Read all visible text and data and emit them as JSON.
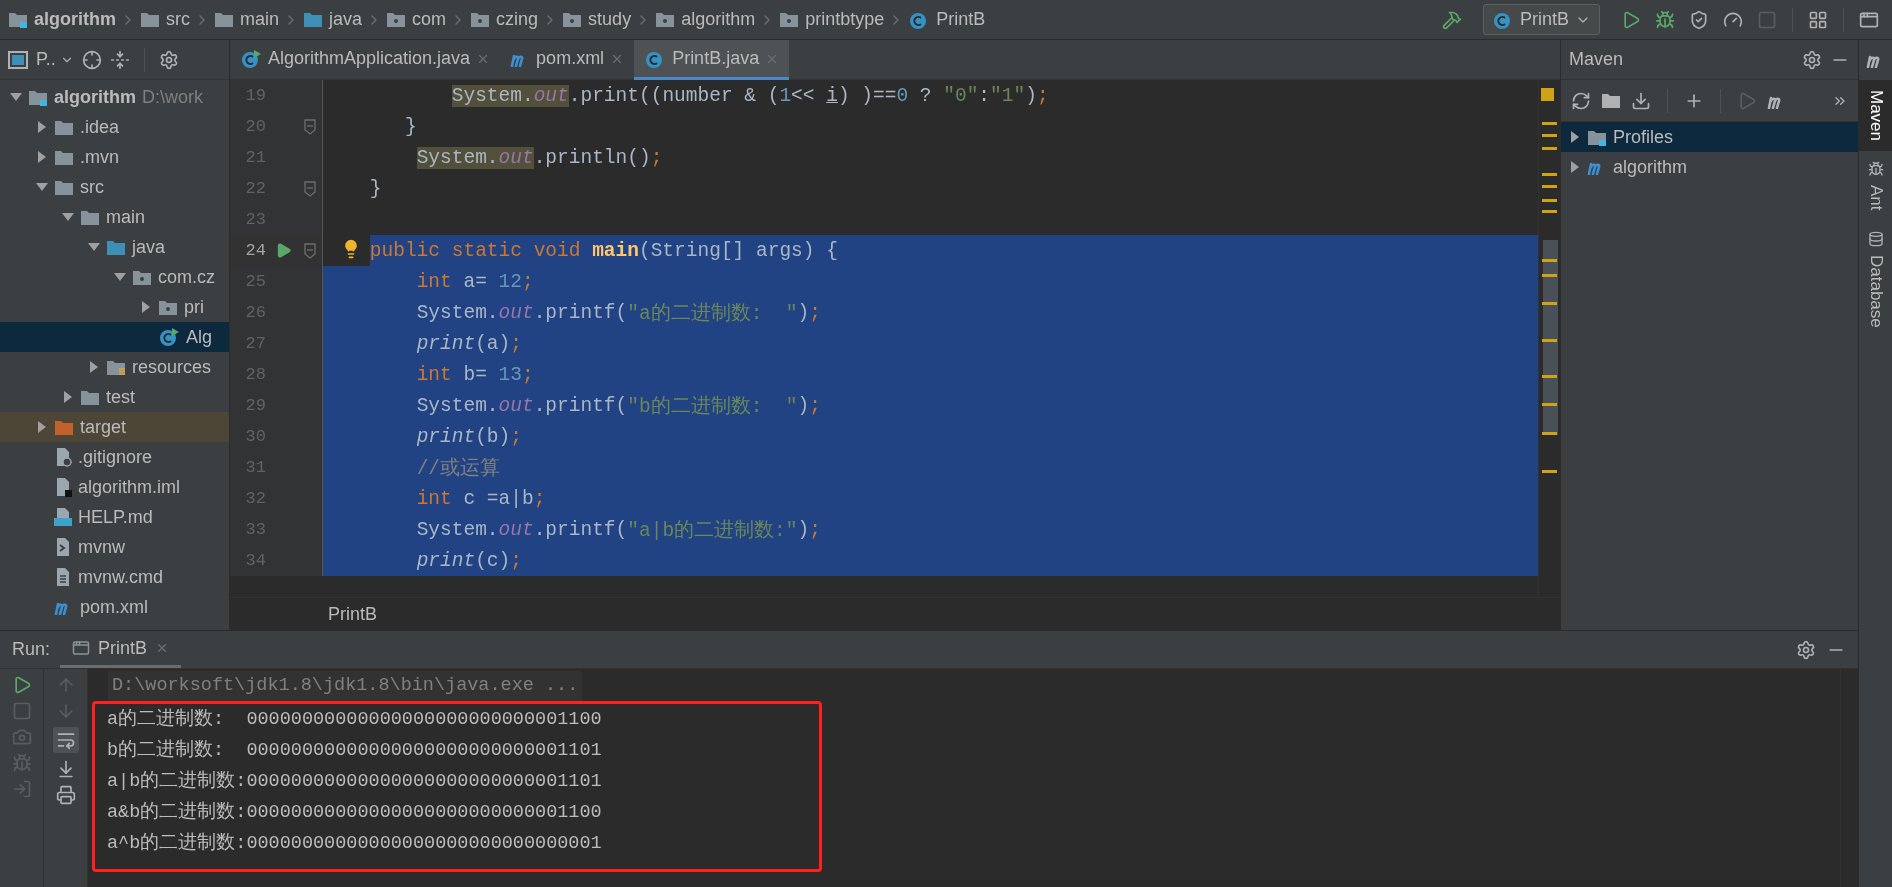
{
  "breadcrumbs": [
    {
      "label": "algorithm",
      "kind": "module"
    },
    {
      "label": "src",
      "kind": "folder"
    },
    {
      "label": "main",
      "kind": "folder"
    },
    {
      "label": "java",
      "kind": "source"
    },
    {
      "label": "com",
      "kind": "package"
    },
    {
      "label": "czing",
      "kind": "package"
    },
    {
      "label": "study",
      "kind": "package"
    },
    {
      "label": "algorithm",
      "kind": "package"
    },
    {
      "label": "printbtype",
      "kind": "package"
    },
    {
      "label": "PrintB",
      "kind": "class"
    }
  ],
  "run_config": {
    "label": "PrintB"
  },
  "project_panel": {
    "title": "P.."
  },
  "project_tree": [
    {
      "label": "algorithm",
      "path": "D:\\work",
      "kind": "module",
      "expanded": true,
      "selected": false,
      "children": [
        {
          "label": ".idea",
          "kind": "folder",
          "expanded": false,
          "selected": false
        },
        {
          "label": ".mvn",
          "kind": "folder",
          "expanded": false,
          "selected": false
        },
        {
          "label": "src",
          "kind": "folder",
          "expanded": true,
          "selected": false,
          "children": [
            {
              "label": "main",
              "kind": "folder",
              "expanded": true,
              "selected": false,
              "children": [
                {
                  "label": "java",
                  "kind": "source",
                  "expanded": true,
                  "selected": false,
                  "children": [
                    {
                      "label": "com.cz",
                      "kind": "package",
                      "expanded": true,
                      "selected": false,
                      "children": [
                        {
                          "label": "pri",
                          "kind": "package",
                          "expanded": false,
                          "selected": false
                        },
                        {
                          "label": "Alg",
                          "kind": "appclass",
                          "selected": true
                        }
                      ]
                    }
                  ]
                },
                {
                  "label": "resources",
                  "kind": "resources",
                  "expanded": false,
                  "selected": false
                }
              ]
            },
            {
              "label": "test",
              "kind": "folder",
              "expanded": false,
              "selected": false
            }
          ]
        },
        {
          "label": "target",
          "kind": "excluded",
          "expanded": false,
          "selected": false
        },
        {
          "label": ".gitignore",
          "kind": "ignore",
          "selected": false
        },
        {
          "label": "algorithm.iml",
          "kind": "iml",
          "selected": false
        },
        {
          "label": "HELP.md",
          "kind": "markdown",
          "selected": false
        },
        {
          "label": "mvnw",
          "kind": "shell",
          "selected": false
        },
        {
          "label": "mvnw.cmd",
          "kind": "text",
          "selected": false
        },
        {
          "label": "pom.xml",
          "kind": "maven",
          "selected": false
        }
      ]
    }
  ],
  "editor_tabs": [
    {
      "label": "AlgorithmApplication.java",
      "kind": "appclass",
      "selected": false
    },
    {
      "label": "pom.xml",
      "kind": "maven",
      "selected": false
    },
    {
      "label": "PrintB.java",
      "kind": "class",
      "selected": true
    }
  ],
  "code_lines": [
    {
      "number": "19",
      "caret": false,
      "run": false,
      "fold": false,
      "bulb": false,
      "selected": false,
      "segments": [
        {
          "text": "           System.",
          "kind": "usage"
        },
        {
          "text": "out",
          "kind": "usagefield"
        },
        {
          "text": ".print((number & (",
          "kind": "plain"
        },
        {
          "text": "1",
          "kind": "number"
        },
        {
          "text": "<< ",
          "kind": "plain"
        },
        {
          "text": "i",
          "kind": "var"
        },
        {
          "text": ") )==",
          "kind": "plain"
        },
        {
          "text": "0",
          "kind": "number"
        },
        {
          "text": " ? ",
          "kind": "plain"
        },
        {
          "text": "\"0\"",
          "kind": "string"
        },
        {
          "text": ":",
          "kind": "plain"
        },
        {
          "text": "\"1\"",
          "kind": "string"
        },
        {
          "text": ")",
          "kind": "plain"
        },
        {
          "text": ";",
          "kind": "punct"
        }
      ]
    },
    {
      "number": "20",
      "caret": false,
      "run": false,
      "fold": true,
      "bulb": false,
      "selected": false,
      "segments": [
        {
          "text": "       }",
          "kind": "plain"
        }
      ]
    },
    {
      "number": "21",
      "caret": false,
      "run": false,
      "fold": false,
      "bulb": false,
      "selected": false,
      "segments": [
        {
          "text": "        System.",
          "kind": "usage"
        },
        {
          "text": "out",
          "kind": "usagefield"
        },
        {
          "text": ".println()",
          "kind": "plain"
        },
        {
          "text": ";",
          "kind": "punct"
        }
      ]
    },
    {
      "number": "22",
      "caret": false,
      "run": false,
      "fold": true,
      "bulb": false,
      "selected": false,
      "segments": [
        {
          "text": "    }",
          "kind": "plain"
        }
      ]
    },
    {
      "number": "23",
      "caret": false,
      "run": false,
      "fold": false,
      "bulb": false,
      "selected": false
    },
    {
      "number": "24",
      "caret": true,
      "run": true,
      "fold": true,
      "bulb": true,
      "selected": true,
      "segments": [
        {
          "text": "    public static void ",
          "kind": "keyword"
        },
        {
          "text": "main",
          "kind": "decl"
        },
        {
          "text": "(String[] args) {",
          "kind": "plain"
        }
      ]
    },
    {
      "number": "25",
      "caret": false,
      "run": false,
      "fold": false,
      "bulb": false,
      "selected": true,
      "segments": [
        {
          "text": "        int",
          "kind": "keyword"
        },
        {
          "text": " a= ",
          "kind": "plain"
        },
        {
          "text": "12",
          "kind": "number"
        },
        {
          "text": ";",
          "kind": "punct"
        }
      ]
    },
    {
      "number": "26",
      "caret": false,
      "run": false,
      "fold": false,
      "bulb": false,
      "selected": true,
      "segments": [
        {
          "text": "        System.",
          "kind": "plain"
        },
        {
          "text": "out",
          "kind": "field"
        },
        {
          "text": ".printf(",
          "kind": "plain"
        },
        {
          "text": "\"a的二进制数:  \"",
          "kind": "string"
        },
        {
          "text": ")",
          "kind": "plain"
        },
        {
          "text": ";",
          "kind": "punct"
        }
      ]
    },
    {
      "number": "27",
      "caret": false,
      "run": false,
      "fold": false,
      "bulb": false,
      "selected": true,
      "segments": [
        {
          "text": "        print",
          "kind": "call"
        },
        {
          "text": "(a)",
          "kind": "plain"
        },
        {
          "text": ";",
          "kind": "punct"
        }
      ]
    },
    {
      "number": "28",
      "caret": false,
      "run": false,
      "fold": false,
      "bulb": false,
      "selected": true,
      "segments": [
        {
          "text": "        int",
          "kind": "keyword"
        },
        {
          "text": " b= ",
          "kind": "plain"
        },
        {
          "text": "13",
          "kind": "number"
        },
        {
          "text": ";",
          "kind": "punct"
        }
      ]
    },
    {
      "number": "29",
      "caret": false,
      "run": false,
      "fold": false,
      "bulb": false,
      "selected": true,
      "segments": [
        {
          "text": "        System.",
          "kind": "plain"
        },
        {
          "text": "out",
          "kind": "field"
        },
        {
          "text": ".printf(",
          "kind": "plain"
        },
        {
          "text": "\"b的二进制数:  \"",
          "kind": "string"
        },
        {
          "text": ")",
          "kind": "plain"
        },
        {
          "text": ";",
          "kind": "punct"
        }
      ]
    },
    {
      "number": "30",
      "caret": false,
      "run": false,
      "fold": false,
      "bulb": false,
      "selected": true,
      "segments": [
        {
          "text": "        print",
          "kind": "call"
        },
        {
          "text": "(b)",
          "kind": "plain"
        },
        {
          "text": ";",
          "kind": "punct"
        }
      ]
    },
    {
      "number": "31",
      "caret": false,
      "run": false,
      "fold": false,
      "bulb": false,
      "selected": true,
      "segments": [
        {
          "text": "        //或运算",
          "kind": "comment"
        }
      ]
    },
    {
      "number": "32",
      "caret": false,
      "run": false,
      "fold": false,
      "bulb": false,
      "selected": true,
      "segments": [
        {
          "text": "        int",
          "kind": "keyword"
        },
        {
          "text": " c =a|b",
          "kind": "plain"
        },
        {
          "text": ";",
          "kind": "punct"
        }
      ]
    },
    {
      "number": "33",
      "caret": false,
      "run": false,
      "fold": false,
      "bulb": false,
      "selected": true,
      "segments": [
        {
          "text": "        System.",
          "kind": "plain"
        },
        {
          "text": "out",
          "kind": "field"
        },
        {
          "text": ".printf(",
          "kind": "plain"
        },
        {
          "text": "\"a|b的二进制数:\"",
          "kind": "string"
        },
        {
          "text": ")",
          "kind": "plain"
        },
        {
          "text": ";",
          "kind": "punct"
        }
      ]
    },
    {
      "number": "34",
      "caret": false,
      "run": false,
      "fold": false,
      "bulb": false,
      "selected": true,
      "segments": [
        {
          "text": "        print",
          "kind": "call"
        },
        {
          "text": "(c)",
          "kind": "plain"
        },
        {
          "text": ";",
          "kind": "punct"
        }
      ]
    }
  ],
  "editor_breadcrumb": "PrintB",
  "maven_panel": {
    "title": "Maven",
    "tree": [
      {
        "label": "Profiles",
        "kind": "profiles",
        "selected": true
      },
      {
        "label": "algorithm",
        "kind": "mavenmodule",
        "selected": false
      }
    ]
  },
  "side_tabs": [
    {
      "label": "Maven",
      "kind": "maven",
      "selected": true
    },
    {
      "label": "Ant",
      "kind": "ant",
      "selected": false
    },
    {
      "label": "Database",
      "kind": "database",
      "selected": false
    }
  ],
  "run_panel": {
    "label": "Run:",
    "tabs": [
      {
        "label": "PrintB",
        "selected": true
      }
    ],
    "command": "D:\\worksoft\\jdk1.8\\jdk1.8\\bin\\java.exe ...",
    "output": [
      "a的二进制数:  00000000000000000000000000001100",
      "b的二进制数:  00000000000000000000000000001101",
      "a|b的二进制数:00000000000000000000000000001101",
      "a&b的二进制数:00000000000000000000000000001100",
      "a^b的二进制数:00000000000000000000000000000001"
    ]
  }
}
